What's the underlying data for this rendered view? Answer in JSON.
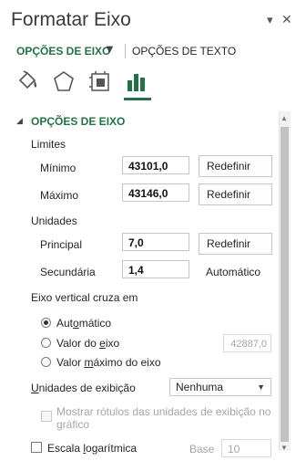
{
  "panel": {
    "title": "Formatar Eixo",
    "pin_icon": "dropdown-arrow-icon",
    "close_icon": "close-icon"
  },
  "tabs": {
    "active": "OPÇÕES DE EIXO",
    "other": "OPÇÕES DE TEXTO"
  },
  "icons": [
    "fill-line-icon",
    "effects-icon",
    "size-properties-icon",
    "axis-options-icon"
  ],
  "section": {
    "title": "OPÇÕES DE EIXO"
  },
  "limits": {
    "heading": "Limites",
    "min_label": "Mínimo",
    "min_value": "43101,0",
    "max_label": "Máximo",
    "max_value": "43146,0",
    "reset": "Redefinir"
  },
  "units": {
    "heading": "Unidades",
    "main_label": "Principal",
    "main_value": "7,0",
    "minor_label": "Secundária",
    "minor_value": "1,4",
    "minor_status": "Automático",
    "reset": "Redefinir"
  },
  "cross": {
    "heading": "Eixo vertical cruza em",
    "auto_label_pre": "Aut",
    "auto_label_u": "o",
    "auto_label_post": "mático",
    "value_label_pre": "Valor do ",
    "value_label_u": "e",
    "value_label_post": "ixo",
    "value_field": "42887,0",
    "max_label_pre": "Valor ",
    "max_label_u": "m",
    "max_label_post": "áximo do eixo"
  },
  "display_units": {
    "label_u": "U",
    "label_post": "nidades de exibição",
    "selected": "Nenhuma",
    "show_label_line1": "Mostrar rótulos das unidades de exibição no",
    "show_label_line2": "gráfico"
  },
  "log": {
    "label_pre": "Escala ",
    "label_u": "l",
    "label_post": "ogarítmica",
    "base_label": "Base",
    "base_value": "10"
  },
  "colors": {
    "accent": "#217346",
    "text": "#262626",
    "disabled": "#a6a6a6"
  }
}
